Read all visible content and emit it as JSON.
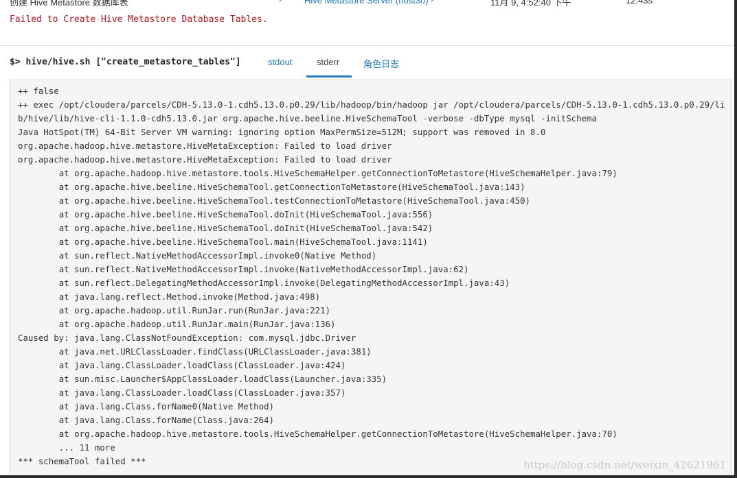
{
  "header": {
    "command_name": "创建 Hive Metastore 数据库表",
    "role": "Hive Metastore Server (host30)",
    "start_time": "11月 9, 4:52:40 下午",
    "duration": "12.43s",
    "error": "Failed to Create Hive Metastore Database Tables."
  },
  "command": {
    "prompt": "$>",
    "text": "hive/hive.sh [\"create_metastore_tables\"]"
  },
  "tabs": {
    "stdout": "stdout",
    "stderr": "stderr",
    "role_log": "角色日志",
    "active": "stderr"
  },
  "log_lines": [
    "++ false",
    "++ exec /opt/cloudera/parcels/CDH-5.13.0-1.cdh5.13.0.p0.29/lib/hadoop/bin/hadoop jar /opt/cloudera/parcels/CDH-5.13.0-1.cdh5.13.0.p0.29/lib/hive/lib/hive-cli-1.1.0-cdh5.13.0.jar org.apache.hive.beeline.HiveSchemaTool -verbose -dbType mysql -initSchema",
    "Java HotSpot(TM) 64-Bit Server VM warning: ignoring option MaxPermSize=512M; support was removed in 8.0",
    "org.apache.hadoop.hive.metastore.HiveMetaException: Failed to load driver",
    "org.apache.hadoop.hive.metastore.HiveMetaException: Failed to load driver",
    "        at org.apache.hadoop.hive.metastore.tools.HiveSchemaHelper.getConnectionToMetastore(HiveSchemaHelper.java:79)",
    "        at org.apache.hive.beeline.HiveSchemaTool.getConnectionToMetastore(HiveSchemaTool.java:143)",
    "        at org.apache.hive.beeline.HiveSchemaTool.testConnectionToMetastore(HiveSchemaTool.java:450)",
    "        at org.apache.hive.beeline.HiveSchemaTool.doInit(HiveSchemaTool.java:556)",
    "        at org.apache.hive.beeline.HiveSchemaTool.doInit(HiveSchemaTool.java:542)",
    "        at org.apache.hive.beeline.HiveSchemaTool.main(HiveSchemaTool.java:1141)",
    "        at sun.reflect.NativeMethodAccessorImpl.invoke0(Native Method)",
    "        at sun.reflect.NativeMethodAccessorImpl.invoke(NativeMethodAccessorImpl.java:62)",
    "        at sun.reflect.DelegatingMethodAccessorImpl.invoke(DelegatingMethodAccessorImpl.java:43)",
    "        at java.lang.reflect.Method.invoke(Method.java:498)",
    "        at org.apache.hadoop.util.RunJar.run(RunJar.java:221)",
    "        at org.apache.hadoop.util.RunJar.main(RunJar.java:136)",
    "Caused by: java.lang.ClassNotFoundException: com.mysql.jdbc.Driver",
    "        at java.net.URLClassLoader.findClass(URLClassLoader.java:381)",
    "        at java.lang.ClassLoader.loadClass(ClassLoader.java:424)",
    "        at sun.misc.Launcher$AppClassLoader.loadClass(Launcher.java:335)",
    "        at java.lang.ClassLoader.loadClass(ClassLoader.java:357)",
    "        at java.lang.Class.forName0(Native Method)",
    "        at java.lang.Class.forName(Class.java:264)",
    "        at org.apache.hadoop.hive.metastore.tools.HiveSchemaHelper.getConnectionToMetastore(HiveSchemaHelper.java:70)",
    "        ... 11 more",
    "*** schemaTool failed ***"
  ],
  "watermark": "https://blog.csdn.net/weixin_42621961",
  "colors": {
    "link": "#1f7bc0",
    "error": "#b1181c",
    "log_background": "#f5f5f5"
  },
  "icons": {
    "external_link": "external-link-icon"
  }
}
